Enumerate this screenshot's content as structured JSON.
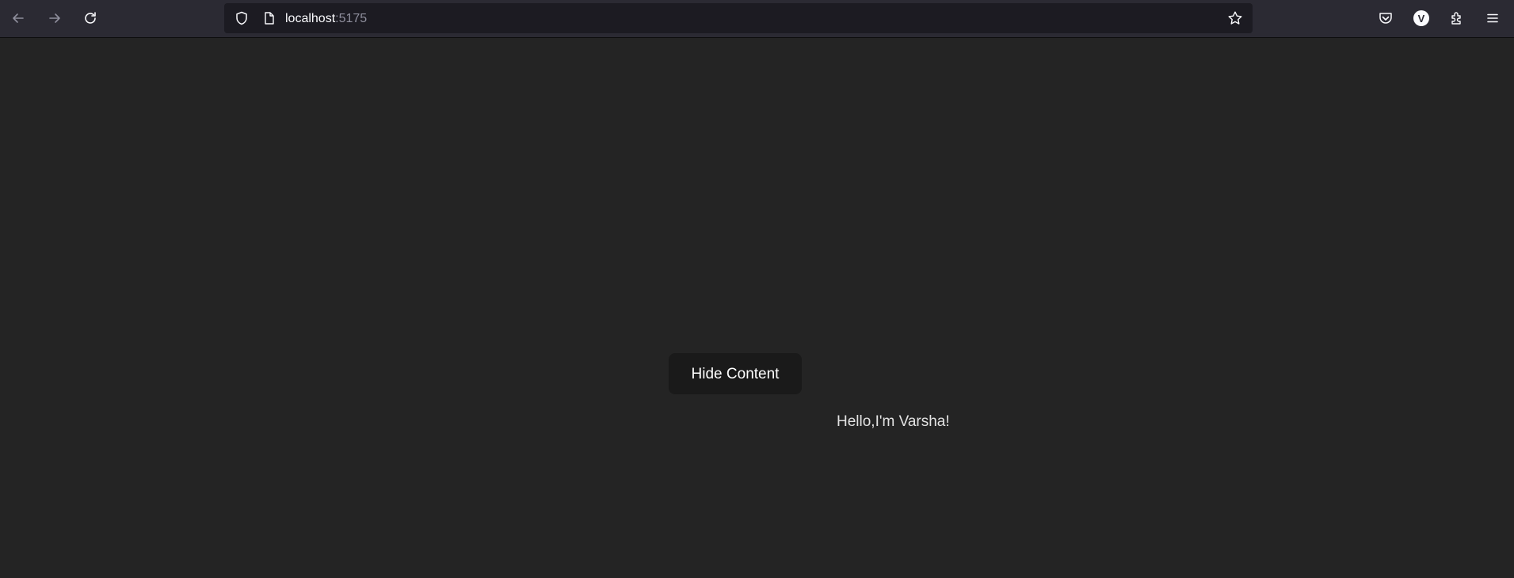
{
  "browser": {
    "url_host": "localhost",
    "url_port": ":5175",
    "profile_initial": "V",
    "icons": {
      "back": "back-arrow-icon",
      "forward": "forward-arrow-icon",
      "reload": "reload-icon",
      "shield": "shield-icon",
      "page": "page-icon",
      "bookmark": "star-icon",
      "pocket": "pocket-icon",
      "profile": "account-avatar-icon",
      "extensions": "puzzle-icon",
      "menu": "hamburger-menu-icon"
    },
    "colors": {
      "toolbar": "#2b2a33",
      "urlbar": "#1c1b22",
      "text": "#fbfbfe",
      "muted": "#8f8f9d"
    }
  },
  "page": {
    "button_label": "Hide Content",
    "greeting": "Hello,I'm Varsha!",
    "colors": {
      "background": "#242424",
      "button_bg": "#1a1a1a",
      "text": "#ffffff"
    }
  }
}
